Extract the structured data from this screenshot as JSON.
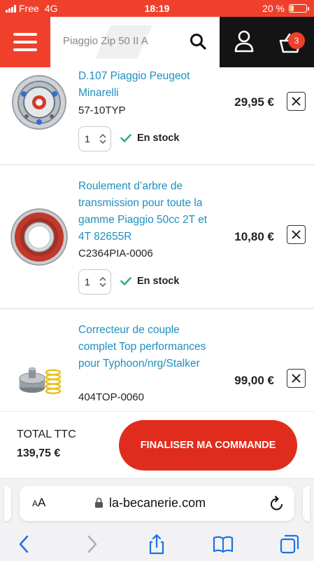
{
  "status_bar": {
    "carrier": "Free",
    "network": "4G",
    "time": "18:19",
    "battery": "20 %",
    "battery_level": 0.2
  },
  "header": {
    "search_value": "Piaggio Zip 50 II A",
    "cart_count": "3"
  },
  "items": [
    {
      "title": "D.107 Piaggio Peugeot Minarelli",
      "sku": "57-10TYP",
      "price": "29,95 €",
      "quantity": "1",
      "stock": "En stock"
    },
    {
      "title": "Roulement d’arbre de transmission pour toute la gamme Piaggio 50cc 2T et 4T 82655R",
      "sku": "C2364PIA-0006",
      "price": "10,80 €",
      "quantity": "1",
      "stock": "En stock"
    },
    {
      "title": "Correcteur de couple complet Top performances pour Typhoon/nrg/Stalker",
      "sku": "404TOP-0060",
      "price": "99,00 €"
    }
  ],
  "summary": {
    "total_label": "TOTAL TTC",
    "total_value": "139,75 €",
    "checkout_label": "FINALISER MA COMMANDE"
  },
  "browser": {
    "text_size": "AA",
    "domain": "la-becanerie.com"
  },
  "colors": {
    "brand_red": "#f0402c",
    "link_blue": "#1c8fbf",
    "stock_green": "#2db36f",
    "dark": "#141414"
  }
}
